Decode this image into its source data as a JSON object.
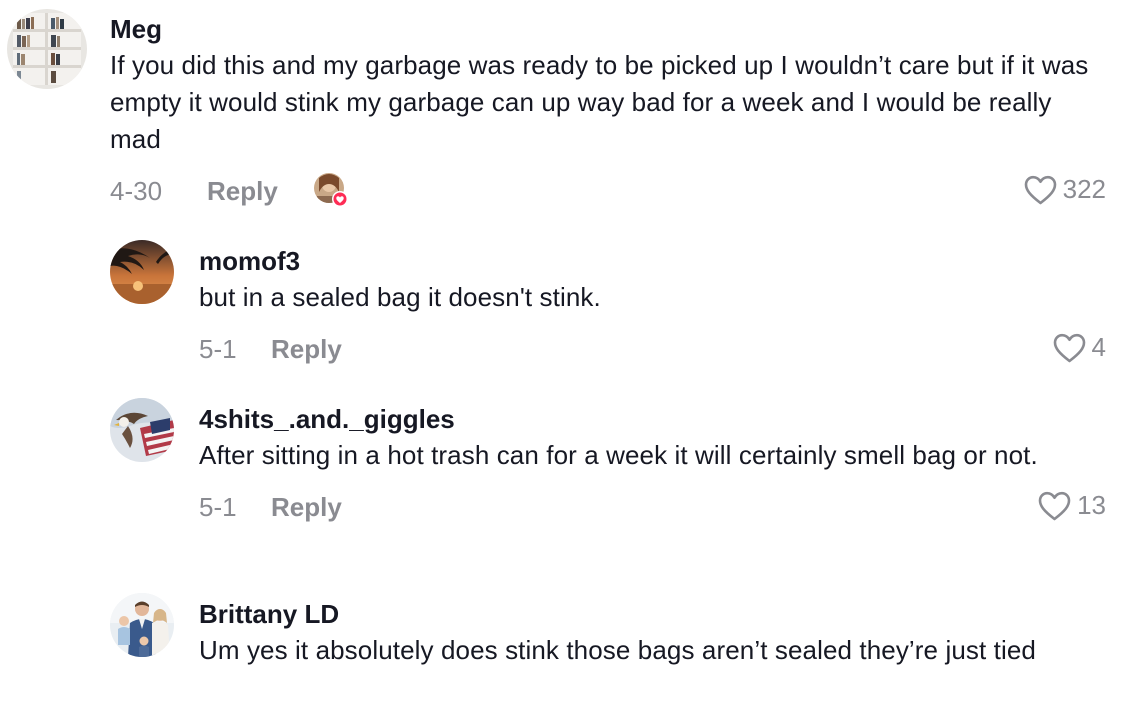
{
  "comments": [
    {
      "username": "Meg",
      "text": "If you did this and my garbage was ready to be picked up I wouldn’t care but if it was empty it would stink my garbage can up way bad for a week and I would be really mad",
      "date": "4-30",
      "reply_label": "Reply",
      "likes": "322",
      "creator_liked": true
    },
    {
      "username": "momof3",
      "text": "but in a sealed bag it doesn't stink.",
      "date": "5-1",
      "reply_label": "Reply",
      "likes": "4"
    },
    {
      "username": "4shits_.and._giggles",
      "text": "After sitting in a hot trash can for a week it will certainly smell bag or not.",
      "date": "5-1",
      "reply_label": "Reply",
      "likes": "13"
    },
    {
      "username": "Brittany LD",
      "text": "Um yes it absolutely does stink those bags aren’t sealed they’re just tied"
    }
  ],
  "colors": {
    "text": "#161823",
    "muted": "#8a8b91",
    "heart_badge": "#fe2c55"
  },
  "icons": {
    "like": "heart-outline-icon",
    "creator_like_badge": "heart-badge-icon"
  }
}
